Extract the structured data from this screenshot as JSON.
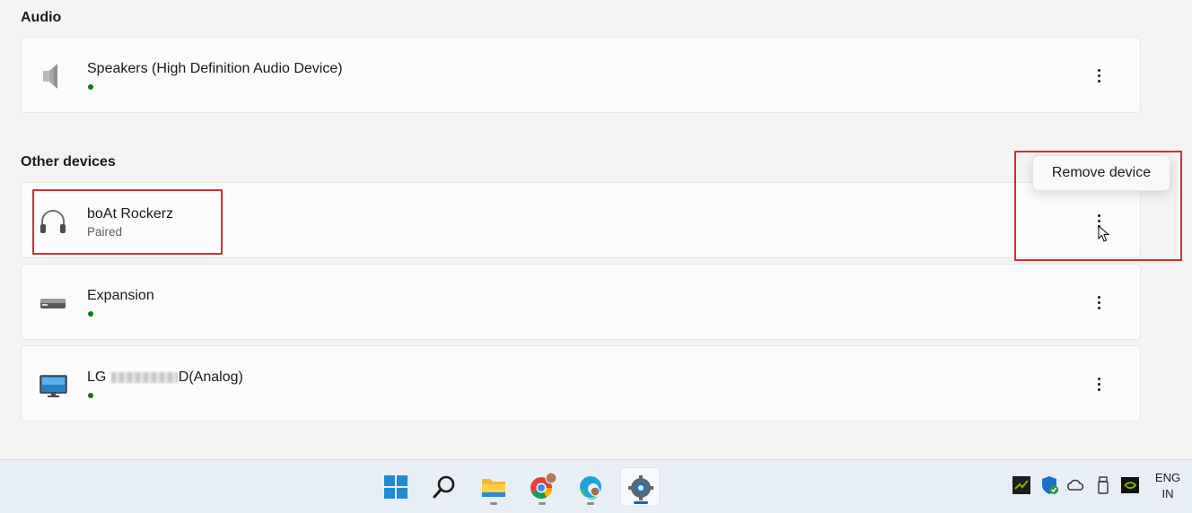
{
  "audio_section": {
    "title": "Audio",
    "devices": [
      {
        "name": "Speakers (High Definition Audio Device)",
        "status": "connected",
        "icon": "speaker-icon"
      }
    ]
  },
  "other_section": {
    "title": "Other devices",
    "devices": [
      {
        "name": "boAt Rockerz",
        "status_text": "Paired",
        "icon": "headphones-icon"
      },
      {
        "name": "Expansion",
        "status": "connected",
        "icon": "drive-icon"
      },
      {
        "name_prefix": "LG ",
        "name_suffix": "D(Analog)",
        "status": "connected",
        "icon": "monitor-icon"
      }
    ]
  },
  "context_menu": {
    "items": [
      {
        "label": "Remove device"
      }
    ]
  },
  "taskbar": {
    "apps": [
      "start-icon",
      "search-icon",
      "file-explorer-icon",
      "chrome-icon",
      "edge-icon",
      "settings-icon"
    ],
    "active_app": "settings-icon",
    "tray": [
      "nvidia-tray-icon",
      "security-icon",
      "onedrive-icon",
      "usb-icon",
      "nvidia-icon"
    ],
    "language": {
      "line1": "ENG",
      "line2": "IN"
    }
  },
  "colors": {
    "accent": "#0067c0",
    "status_connected": "#0f7b0f",
    "highlight": "#d32f2f"
  }
}
